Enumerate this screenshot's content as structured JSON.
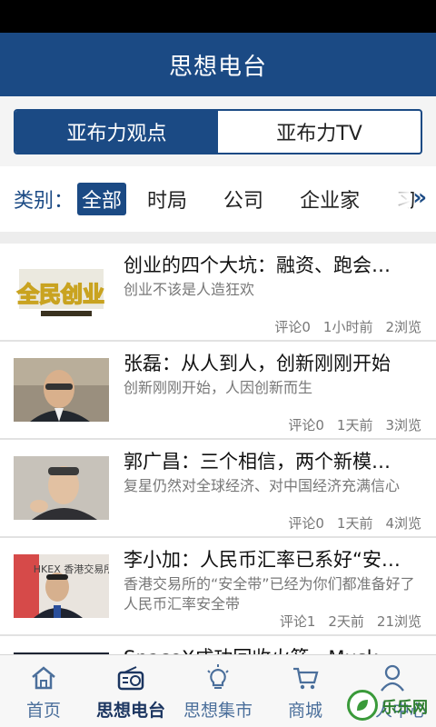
{
  "header": {
    "title": "思想电台"
  },
  "segment": {
    "tabs": [
      {
        "label": "亚布力观点",
        "active": true
      },
      {
        "label": "亚布力TV",
        "active": false
      }
    ]
  },
  "categories": {
    "label": "类别：",
    "items": [
      "全部",
      "时局",
      "公司",
      "企业家",
      "习"
    ],
    "selected": "全部",
    "more_icon": "double-chevron-right-icon"
  },
  "news": [
    {
      "title": "创业的四个大坑：融资、跑会…",
      "summary": "创业不该是人造狂欢",
      "comments": "评论0",
      "time": "1小时前",
      "views": "2浏览",
      "thumb_text": "全民创业"
    },
    {
      "title": "张磊：从人到人，创新刚刚开始",
      "summary": "创新刚刚开始，人因创新而生",
      "comments": "评论0",
      "time": "1天前",
      "views": "3浏览"
    },
    {
      "title": "郭广昌：三个相信，两个新模…",
      "summary": "复星仍然对全球经济、对中国经济充满信心",
      "comments": "评论0",
      "time": "1天前",
      "views": "4浏览"
    },
    {
      "title": "李小加：人民币汇率已系好“安…",
      "summary": "香港交易所的“安全带”已经为你们都准备好了人民币汇率安全带",
      "comments": "评论1",
      "time": "2天前",
      "views": "21浏览",
      "thumb_text": "HKEX 香港交易所"
    },
    {
      "title": "SpaceX成功回收火箭，Musk…"
    }
  ],
  "bottom_nav": [
    {
      "label": "首页",
      "icon": "home-icon",
      "active": false
    },
    {
      "label": "思想电台",
      "icon": "radio-icon",
      "active": true
    },
    {
      "label": "思想集市",
      "icon": "lightbulb-icon",
      "active": false
    },
    {
      "label": "商城",
      "icon": "cart-icon",
      "active": false
    },
    {
      "label": "个人中心",
      "icon": "person-icon",
      "active": false
    }
  ],
  "watermark": {
    "text": "乐乐网"
  },
  "colors": {
    "primary": "#1b4a84",
    "nav_text": "#4b6f9b",
    "meta_text": "#777777"
  }
}
